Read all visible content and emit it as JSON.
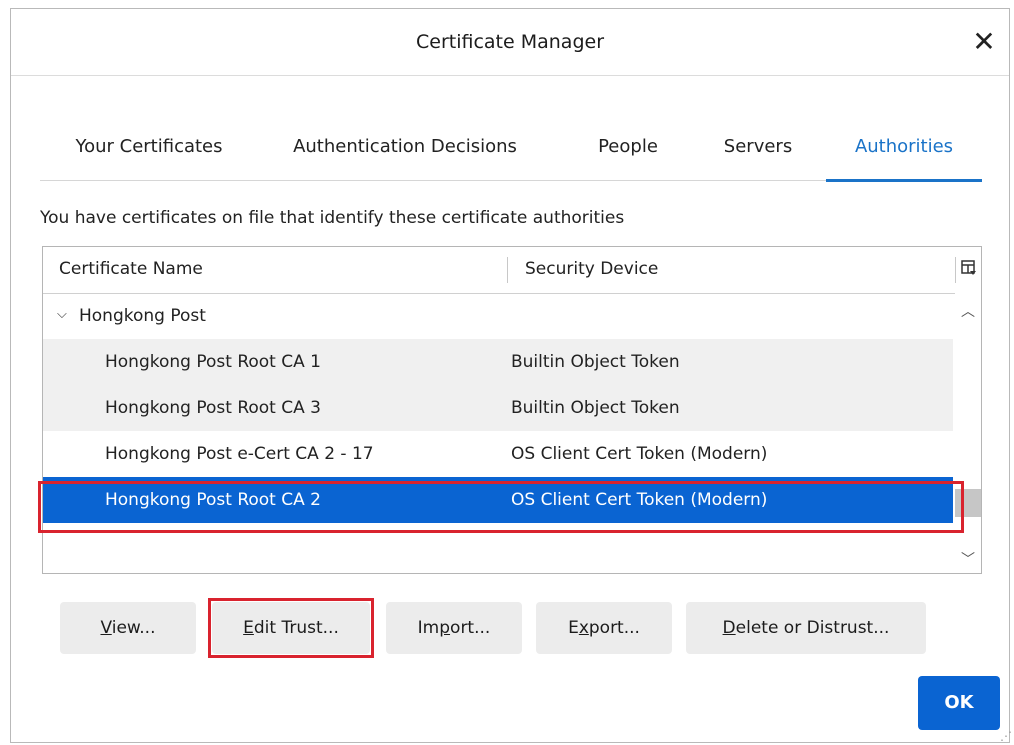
{
  "window": {
    "title": "Certificate Manager"
  },
  "tabs": [
    {
      "label": "Your Certificates",
      "active": false
    },
    {
      "label": "Authentication Decisions",
      "active": false
    },
    {
      "label": "People",
      "active": false
    },
    {
      "label": "Servers",
      "active": false
    },
    {
      "label": "Authorities",
      "active": true
    }
  ],
  "description": "You have certificates on file that identify these certificate authorities",
  "table": {
    "columns": [
      "Certificate Name",
      "Security Device"
    ],
    "group": {
      "label": "Hongkong Post",
      "expanded": true
    },
    "rows": [
      {
        "name": "Hongkong Post Root CA 1",
        "device": "Builtin Object Token",
        "selected": false
      },
      {
        "name": "Hongkong Post Root CA 3",
        "device": "Builtin Object Token",
        "selected": false
      },
      {
        "name": "Hongkong Post e-Cert CA 2 - 17",
        "device": "OS Client Cert Token (Modern)",
        "selected": false
      },
      {
        "name": "Hongkong Post Root CA 2",
        "device": "OS Client Cert Token (Modern)",
        "selected": true
      }
    ]
  },
  "buttons": {
    "view": {
      "underline": "V",
      "rest": "iew..."
    },
    "edit_trust": {
      "underline": "E",
      "rest": "dit Trust..."
    },
    "import": {
      "pre": "Im",
      "underline": "p",
      "rest": "ort..."
    },
    "export": {
      "pre": "E",
      "underline": "x",
      "rest": "port..."
    },
    "delete": {
      "underline": "D",
      "rest": "elete or Distrust..."
    },
    "ok": "OK"
  },
  "colors": {
    "accent": "#1a73c8",
    "selection": "#0a64d2",
    "highlight_box": "#d9232e"
  }
}
